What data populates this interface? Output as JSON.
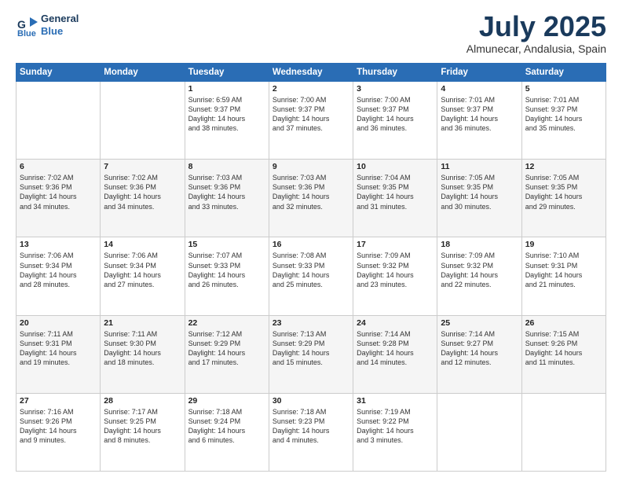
{
  "logo": {
    "line1": "General",
    "line2": "Blue"
  },
  "title": "July 2025",
  "subtitle": "Almunecar, Andalusia, Spain",
  "days_header": [
    "Sunday",
    "Monday",
    "Tuesday",
    "Wednesday",
    "Thursday",
    "Friday",
    "Saturday"
  ],
  "weeks": [
    [
      {
        "day": "",
        "info": ""
      },
      {
        "day": "",
        "info": ""
      },
      {
        "day": "1",
        "info": "Sunrise: 6:59 AM\nSunset: 9:37 PM\nDaylight: 14 hours\nand 38 minutes."
      },
      {
        "day": "2",
        "info": "Sunrise: 7:00 AM\nSunset: 9:37 PM\nDaylight: 14 hours\nand 37 minutes."
      },
      {
        "day": "3",
        "info": "Sunrise: 7:00 AM\nSunset: 9:37 PM\nDaylight: 14 hours\nand 36 minutes."
      },
      {
        "day": "4",
        "info": "Sunrise: 7:01 AM\nSunset: 9:37 PM\nDaylight: 14 hours\nand 36 minutes."
      },
      {
        "day": "5",
        "info": "Sunrise: 7:01 AM\nSunset: 9:37 PM\nDaylight: 14 hours\nand 35 minutes."
      }
    ],
    [
      {
        "day": "6",
        "info": "Sunrise: 7:02 AM\nSunset: 9:36 PM\nDaylight: 14 hours\nand 34 minutes."
      },
      {
        "day": "7",
        "info": "Sunrise: 7:02 AM\nSunset: 9:36 PM\nDaylight: 14 hours\nand 34 minutes."
      },
      {
        "day": "8",
        "info": "Sunrise: 7:03 AM\nSunset: 9:36 PM\nDaylight: 14 hours\nand 33 minutes."
      },
      {
        "day": "9",
        "info": "Sunrise: 7:03 AM\nSunset: 9:36 PM\nDaylight: 14 hours\nand 32 minutes."
      },
      {
        "day": "10",
        "info": "Sunrise: 7:04 AM\nSunset: 9:35 PM\nDaylight: 14 hours\nand 31 minutes."
      },
      {
        "day": "11",
        "info": "Sunrise: 7:05 AM\nSunset: 9:35 PM\nDaylight: 14 hours\nand 30 minutes."
      },
      {
        "day": "12",
        "info": "Sunrise: 7:05 AM\nSunset: 9:35 PM\nDaylight: 14 hours\nand 29 minutes."
      }
    ],
    [
      {
        "day": "13",
        "info": "Sunrise: 7:06 AM\nSunset: 9:34 PM\nDaylight: 14 hours\nand 28 minutes."
      },
      {
        "day": "14",
        "info": "Sunrise: 7:06 AM\nSunset: 9:34 PM\nDaylight: 14 hours\nand 27 minutes."
      },
      {
        "day": "15",
        "info": "Sunrise: 7:07 AM\nSunset: 9:33 PM\nDaylight: 14 hours\nand 26 minutes."
      },
      {
        "day": "16",
        "info": "Sunrise: 7:08 AM\nSunset: 9:33 PM\nDaylight: 14 hours\nand 25 minutes."
      },
      {
        "day": "17",
        "info": "Sunrise: 7:09 AM\nSunset: 9:32 PM\nDaylight: 14 hours\nand 23 minutes."
      },
      {
        "day": "18",
        "info": "Sunrise: 7:09 AM\nSunset: 9:32 PM\nDaylight: 14 hours\nand 22 minutes."
      },
      {
        "day": "19",
        "info": "Sunrise: 7:10 AM\nSunset: 9:31 PM\nDaylight: 14 hours\nand 21 minutes."
      }
    ],
    [
      {
        "day": "20",
        "info": "Sunrise: 7:11 AM\nSunset: 9:31 PM\nDaylight: 14 hours\nand 19 minutes."
      },
      {
        "day": "21",
        "info": "Sunrise: 7:11 AM\nSunset: 9:30 PM\nDaylight: 14 hours\nand 18 minutes."
      },
      {
        "day": "22",
        "info": "Sunrise: 7:12 AM\nSunset: 9:29 PM\nDaylight: 14 hours\nand 17 minutes."
      },
      {
        "day": "23",
        "info": "Sunrise: 7:13 AM\nSunset: 9:29 PM\nDaylight: 14 hours\nand 15 minutes."
      },
      {
        "day": "24",
        "info": "Sunrise: 7:14 AM\nSunset: 9:28 PM\nDaylight: 14 hours\nand 14 minutes."
      },
      {
        "day": "25",
        "info": "Sunrise: 7:14 AM\nSunset: 9:27 PM\nDaylight: 14 hours\nand 12 minutes."
      },
      {
        "day": "26",
        "info": "Sunrise: 7:15 AM\nSunset: 9:26 PM\nDaylight: 14 hours\nand 11 minutes."
      }
    ],
    [
      {
        "day": "27",
        "info": "Sunrise: 7:16 AM\nSunset: 9:26 PM\nDaylight: 14 hours\nand 9 minutes."
      },
      {
        "day": "28",
        "info": "Sunrise: 7:17 AM\nSunset: 9:25 PM\nDaylight: 14 hours\nand 8 minutes."
      },
      {
        "day": "29",
        "info": "Sunrise: 7:18 AM\nSunset: 9:24 PM\nDaylight: 14 hours\nand 6 minutes."
      },
      {
        "day": "30",
        "info": "Sunrise: 7:18 AM\nSunset: 9:23 PM\nDaylight: 14 hours\nand 4 minutes."
      },
      {
        "day": "31",
        "info": "Sunrise: 7:19 AM\nSunset: 9:22 PM\nDaylight: 14 hours\nand 3 minutes."
      },
      {
        "day": "",
        "info": ""
      },
      {
        "day": "",
        "info": ""
      }
    ]
  ]
}
